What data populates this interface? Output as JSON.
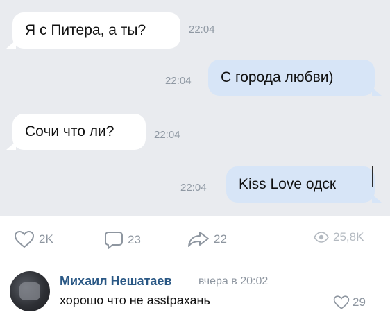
{
  "messages": [
    {
      "direction": "in",
      "text": "Я с Питера, а ты?",
      "time": "22:04"
    },
    {
      "direction": "out",
      "text": "С города любви)",
      "time": "22:04"
    },
    {
      "direction": "in",
      "text": "Сочи что ли?",
      "time": "22:04"
    },
    {
      "direction": "out",
      "text": "Kiss Love одск",
      "time": "22:04"
    }
  ],
  "post_stats": {
    "likes": "2K",
    "comments": "23",
    "shares": "22",
    "views": "25,8K"
  },
  "comment": {
    "author": "Михаил Нешатаев",
    "when": "вчера в 20:02",
    "text": "хорошо что не asstрахань",
    "likes": "29"
  },
  "icons": {
    "like": "heart-outline-icon",
    "comment": "speech-bubble-icon",
    "share": "share-arrow-icon",
    "views": "eye-icon"
  },
  "colors": {
    "chat_background": "#e9ebef",
    "incoming_bubble": "#ffffff",
    "outgoing_bubble": "#d7e5f7",
    "author_link": "#2a5885",
    "muted_text": "#8e96a0"
  }
}
